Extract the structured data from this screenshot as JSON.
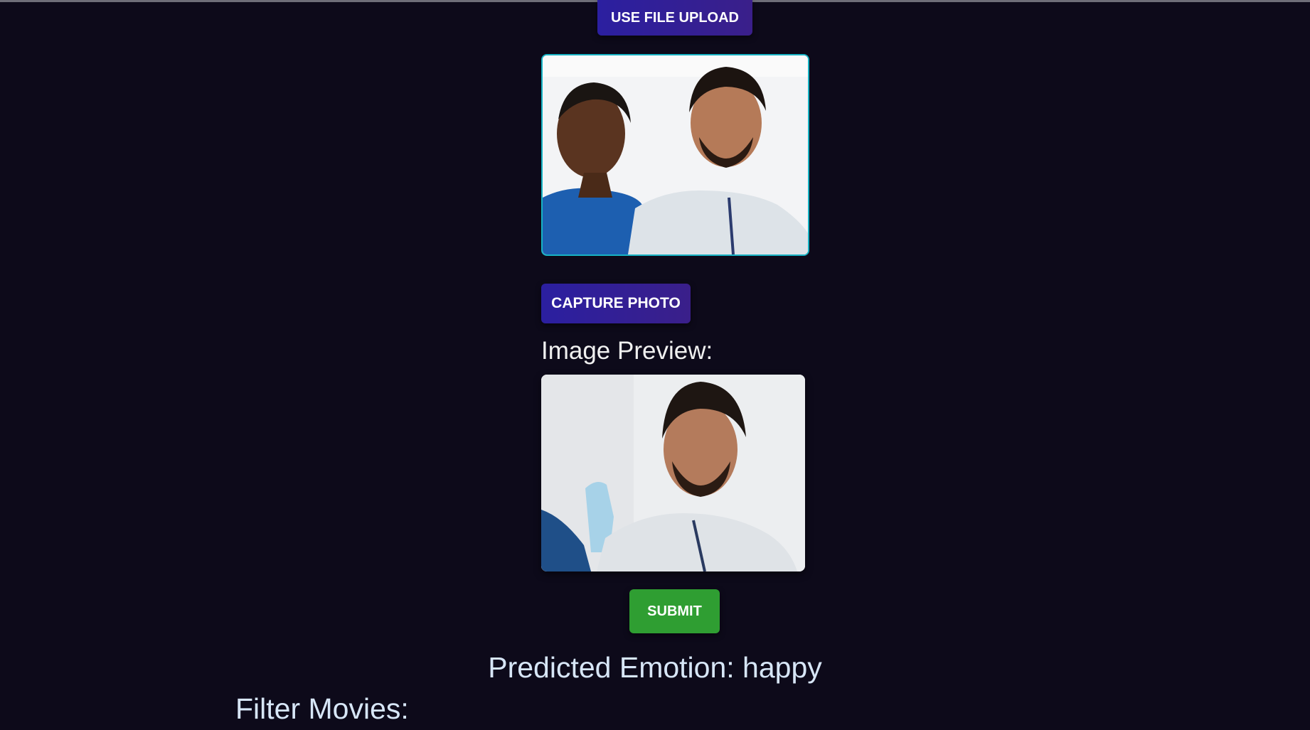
{
  "buttons": {
    "file_upload": "USE FILE UPLOAD",
    "capture": "CAPTURE PHOTO",
    "submit": "SUBMIT"
  },
  "preview": {
    "label": "Image Preview:"
  },
  "result": {
    "predicted_emotion": "Predicted Emotion: happy"
  },
  "filter": {
    "label": "Filter Movies:"
  },
  "colors": {
    "background": "#0d0a1a",
    "primary_button": "#2b1fa0",
    "submit_button": "#2f9e32",
    "webcam_border": "#17b3c4",
    "result_text": "#d7e6f7"
  }
}
